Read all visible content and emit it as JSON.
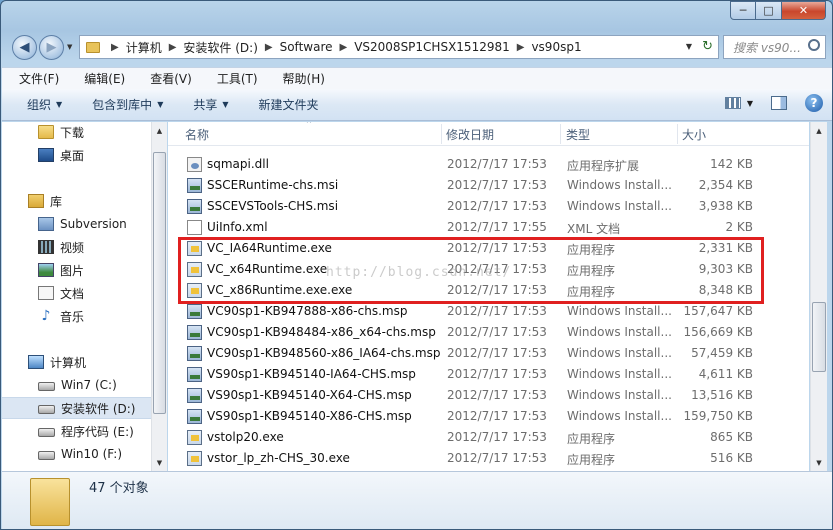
{
  "window": {
    "min": "─",
    "max": "□",
    "close": "✕"
  },
  "address": {
    "crumbs": [
      "计算机",
      "安装软件 (D:)",
      "Software",
      "VS2008SP1CHSX1512981",
      "vs90sp1"
    ],
    "search_placeholder": "搜索 vs90..."
  },
  "menu": [
    "文件(F)",
    "编辑(E)",
    "查看(V)",
    "工具(T)",
    "帮助(H)"
  ],
  "toolbar": {
    "organize": "组织",
    "include": "包含到库中",
    "share": "共享",
    "new_folder": "新建文件夹",
    "help": "?"
  },
  "nav": [
    {
      "label": "下载",
      "icon": "folder-icon"
    },
    {
      "label": "桌面",
      "icon": "desktop-icon"
    },
    {
      "label": "库",
      "icon": "library-icon"
    },
    {
      "label": "Subversion",
      "icon": "subversion-icon"
    },
    {
      "label": "视频",
      "icon": "video-icon"
    },
    {
      "label": "图片",
      "icon": "pictures-icon"
    },
    {
      "label": "文档",
      "icon": "documents-icon"
    },
    {
      "label": "音乐",
      "icon": "music-icon"
    },
    {
      "label": "计算机",
      "icon": "computer-icon"
    },
    {
      "label": "Win7 (C:)",
      "icon": "windows-drive-icon"
    },
    {
      "label": "安装软件 (D:)",
      "icon": "drive-icon",
      "selected": true
    },
    {
      "label": "程序代码 (E:)",
      "icon": "drive-icon"
    },
    {
      "label": "Win10 (F:)",
      "icon": "drive-icon"
    }
  ],
  "columns": {
    "name": "名称",
    "date": "修改日期",
    "type": "类型",
    "size": "大小"
  },
  "files": [
    {
      "name": "sqmapi.dll",
      "date": "2012/7/17 17:53",
      "type": "应用程序扩展",
      "size": "142 KB",
      "icon": "dll-icon"
    },
    {
      "name": "SSCERuntime-chs.msi",
      "date": "2012/7/17 17:53",
      "type": "Windows Install...",
      "size": "2,354 KB",
      "icon": "msi-icon"
    },
    {
      "name": "SSCEVSTools-CHS.msi",
      "date": "2012/7/17 17:53",
      "type": "Windows Install...",
      "size": "3,938 KB",
      "icon": "msi-icon"
    },
    {
      "name": "UiInfo.xml",
      "date": "2012/7/17 17:55",
      "type": "XML 文档",
      "size": "2 KB",
      "icon": "xml-icon"
    },
    {
      "name": "VC_IA64Runtime.exe",
      "date": "2012/7/17 17:53",
      "type": "应用程序",
      "size": "2,331 KB",
      "icon": "exe-icon"
    },
    {
      "name": "VC_x64Runtime.exe",
      "date": "2012/7/17 17:53",
      "type": "应用程序",
      "size": "9,303 KB",
      "icon": "exe-icon"
    },
    {
      "name": "VC_x86Runtime.exe.exe",
      "date": "2012/7/17 17:53",
      "type": "应用程序",
      "size": "8,348 KB",
      "icon": "exe-icon"
    },
    {
      "name": "VC90sp1-KB947888-x86-chs.msp",
      "date": "2012/7/17 17:53",
      "type": "Windows Install...",
      "size": "157,647 KB",
      "icon": "msi-icon"
    },
    {
      "name": "VC90sp1-KB948484-x86_x64-chs.msp",
      "date": "2012/7/17 17:53",
      "type": "Windows Install...",
      "size": "156,669 KB",
      "icon": "msi-icon"
    },
    {
      "name": "VC90sp1-KB948560-x86_IA64-chs.msp",
      "date": "2012/7/17 17:53",
      "type": "Windows Install...",
      "size": "57,459 KB",
      "icon": "msi-icon"
    },
    {
      "name": "VS90sp1-KB945140-IA64-CHS.msp",
      "date": "2012/7/17 17:53",
      "type": "Windows Install...",
      "size": "4,611 KB",
      "icon": "msi-icon"
    },
    {
      "name": "VS90sp1-KB945140-X64-CHS.msp",
      "date": "2012/7/17 17:53",
      "type": "Windows Install...",
      "size": "13,516 KB",
      "icon": "msi-icon"
    },
    {
      "name": "VS90sp1-KB945140-X86-CHS.msp",
      "date": "2012/7/17 17:53",
      "type": "Windows Install...",
      "size": "159,750 KB",
      "icon": "msi-icon"
    },
    {
      "name": "vstolp20.exe",
      "date": "2012/7/17 17:53",
      "type": "应用程序",
      "size": "865 KB",
      "icon": "exe-icon"
    },
    {
      "name": "vstor_lp_zh-CHS_30.exe",
      "date": "2012/7/17 17:53",
      "type": "应用程序",
      "size": "516 KB",
      "icon": "exe-icon"
    }
  ],
  "watermark": "http://blog.csdn.net/",
  "status": {
    "count": "47 个对象"
  },
  "accent": {
    "highlight_border": "#e02020",
    "selected_bg": "#dbe6f3"
  }
}
